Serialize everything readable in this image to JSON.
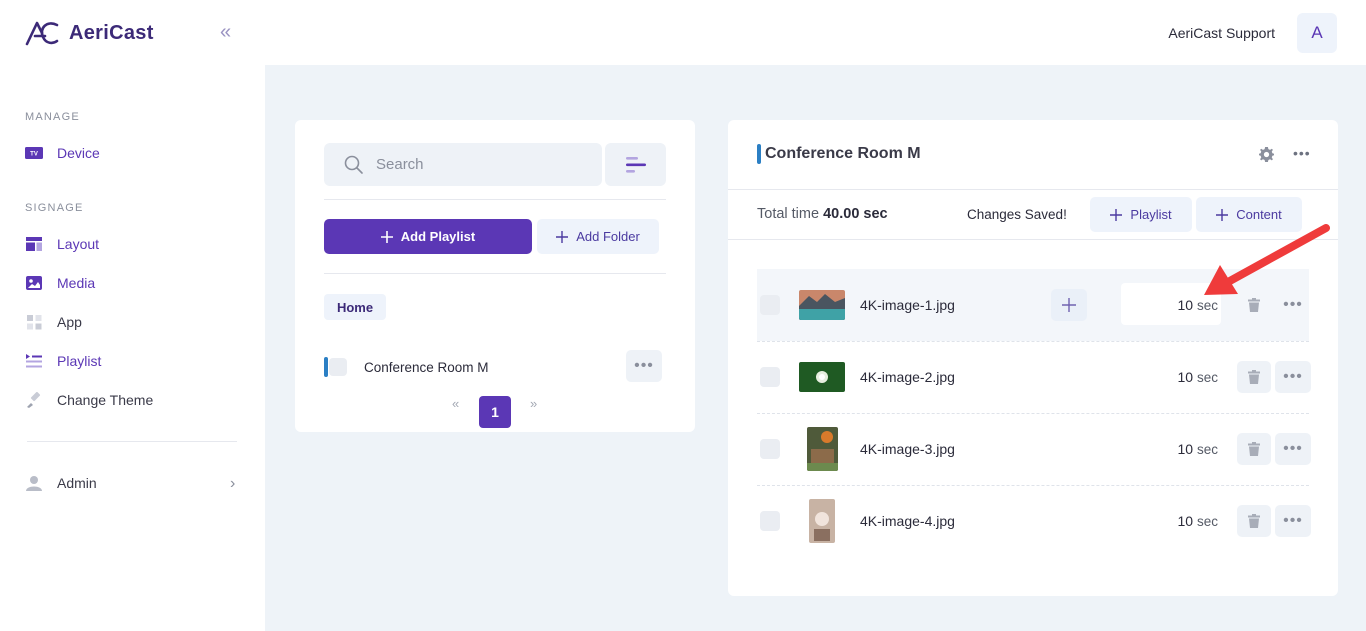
{
  "app": {
    "brand": "AeriCast"
  },
  "sidebar": {
    "manage_label": "MANAGE",
    "signage_label": "SIGNAGE",
    "items": [
      {
        "label": "Device",
        "icon": "tv-icon",
        "tv_badge": "TV"
      },
      {
        "label": "Layout",
        "icon": "layout-icon"
      },
      {
        "label": "Media",
        "icon": "image-icon"
      },
      {
        "label": "App",
        "icon": "apps-grid-icon"
      },
      {
        "label": "Playlist",
        "icon": "playlist-icon"
      },
      {
        "label": "Change Theme",
        "icon": "paint-brush-icon"
      }
    ],
    "admin_label": "Admin"
  },
  "header": {
    "user_name": "AeriCast Support",
    "avatar_letter": "A"
  },
  "playlists_panel": {
    "search_placeholder": "Search",
    "add_playlist_label": "Add Playlist",
    "add_folder_label": "Add Folder",
    "breadcrumb": "Home",
    "playlists": [
      {
        "name": "Conference Room M"
      }
    ],
    "pagination": {
      "prev": "«",
      "current": "1",
      "next": "»"
    }
  },
  "playlist_detail": {
    "title": "Conference Room M",
    "total_label": "Total time",
    "total_value": "40.00 sec",
    "status": "Changes Saved!",
    "add_playlist_label": "Playlist",
    "add_content_label": "Content",
    "items": [
      {
        "file": "4K-image-1.jpg",
        "duration": "10",
        "unit": "sec"
      },
      {
        "file": "4K-image-2.jpg",
        "duration": "10",
        "unit": "sec"
      },
      {
        "file": "4K-image-3.jpg",
        "duration": "10",
        "unit": "sec"
      },
      {
        "file": "4K-image-4.jpg",
        "duration": "10",
        "unit": "sec"
      }
    ]
  },
  "colors": {
    "accent": "#5b37b5",
    "sidebar_bg": "#ffffff",
    "page_bg": "#eef3f8",
    "annotation_arrow": "#ef3b3b"
  }
}
